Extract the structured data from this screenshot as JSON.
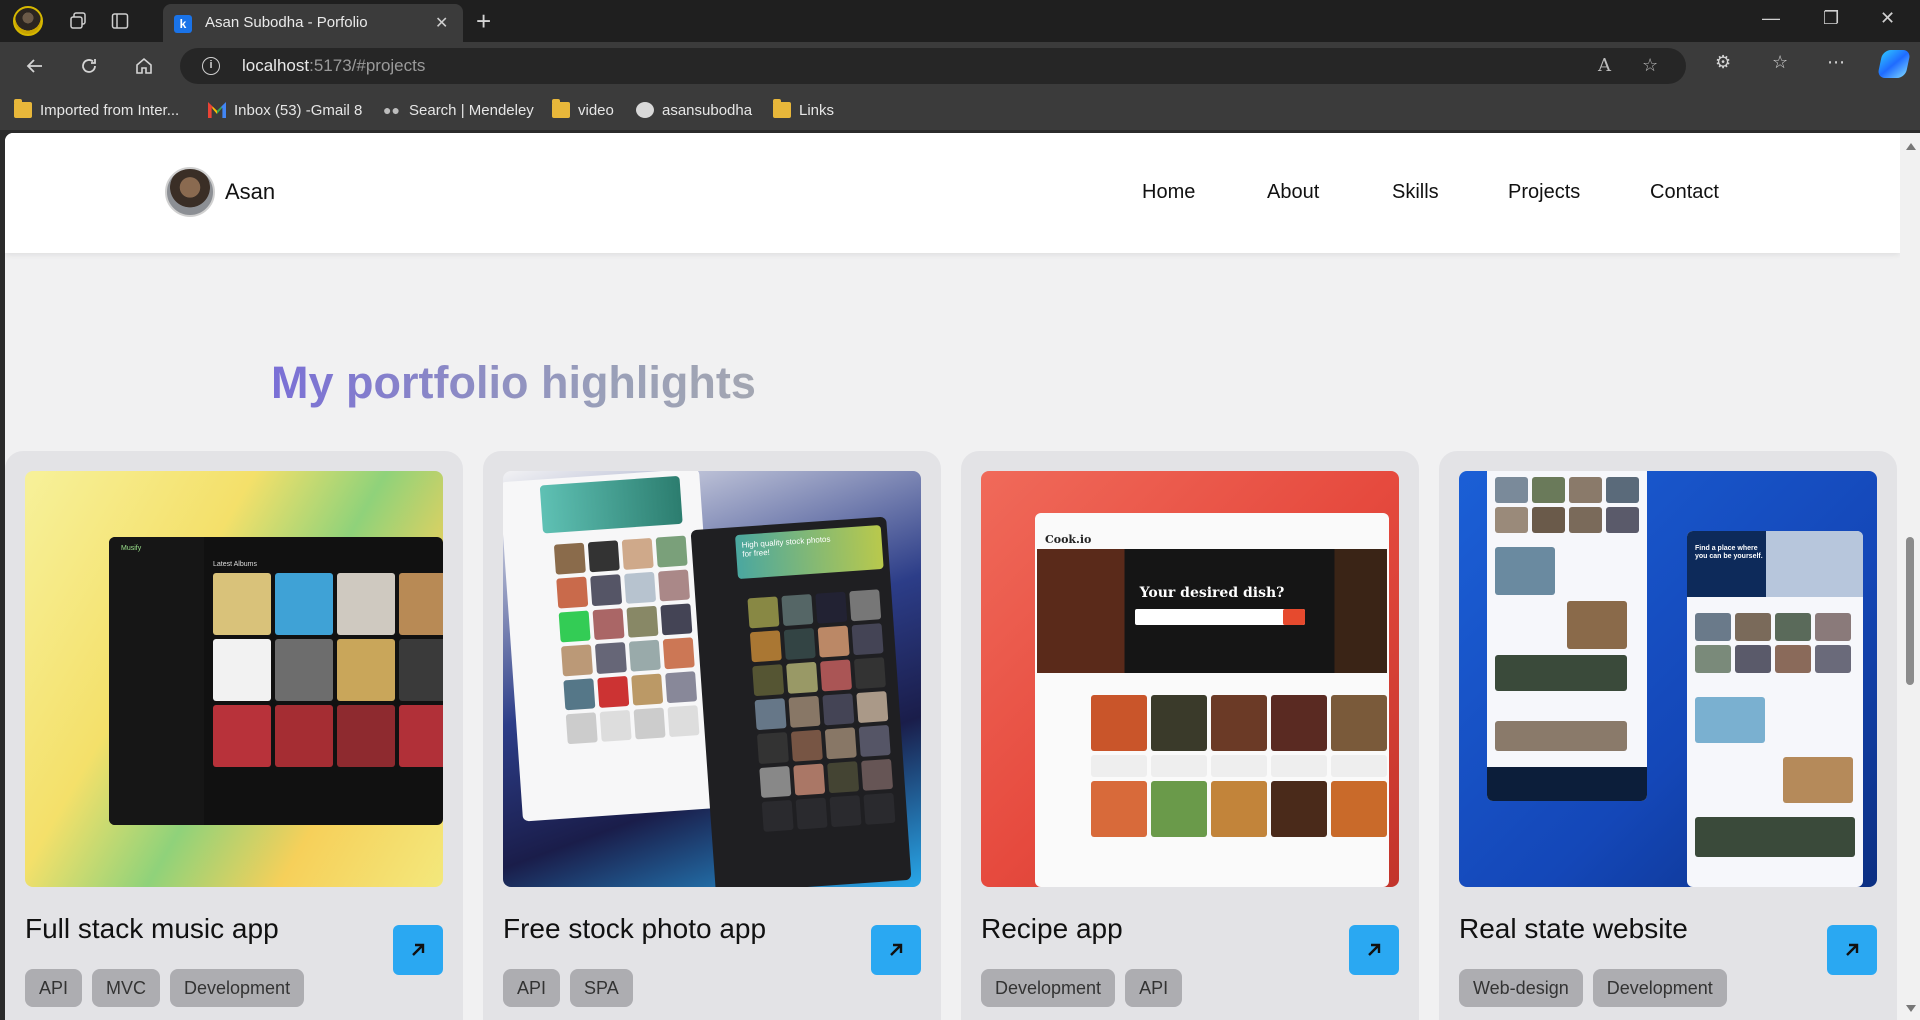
{
  "browser": {
    "tab_title": "Asan Subodha - Porfolio",
    "url_host": "localhost",
    "url_rest": ":5173/#projects",
    "bookmarks": [
      {
        "label": "Imported from Inter...",
        "icon": "folder-icon"
      },
      {
        "label": "Inbox (53) -Gmail 8",
        "icon": "gmail-icon"
      },
      {
        "label": "Search | Mendeley",
        "icon": "mendeley-icon"
      },
      {
        "label": "video",
        "icon": "folder-icon"
      },
      {
        "label": "asansubodha",
        "icon": "github-icon"
      },
      {
        "label": "Links",
        "icon": "folder-icon"
      }
    ]
  },
  "site": {
    "brand": "Asan",
    "nav": [
      "Home",
      "About",
      "Skills",
      "Projects",
      "Contact"
    ],
    "section_title": "My portfolio highlights",
    "projects": [
      {
        "title": "Full stack music app",
        "tags": [
          "API",
          "MVC",
          "Development"
        ]
      },
      {
        "title": "Free stock photo app",
        "tags": [
          "API",
          "SPA"
        ]
      },
      {
        "title": "Recipe app",
        "tags": [
          "Development",
          "API"
        ]
      },
      {
        "title": "Real state website",
        "tags": [
          "Web-design",
          "Development"
        ]
      }
    ],
    "thumb_text": {
      "music_app": "Musify",
      "music_heading": "Latest Albums",
      "photo_heading": "High quality stock photos for free!",
      "recipe_logo": "Cook.io",
      "recipe_heading": "Your desired dish?",
      "estate_heading": "Find a place where you can be yourself."
    }
  },
  "colors": {
    "accent": "#2aa8f2",
    "title_gradient_start": "#7a6fd6",
    "card_bg": "#e3e3e6",
    "tag_bg": "#adadb1"
  }
}
